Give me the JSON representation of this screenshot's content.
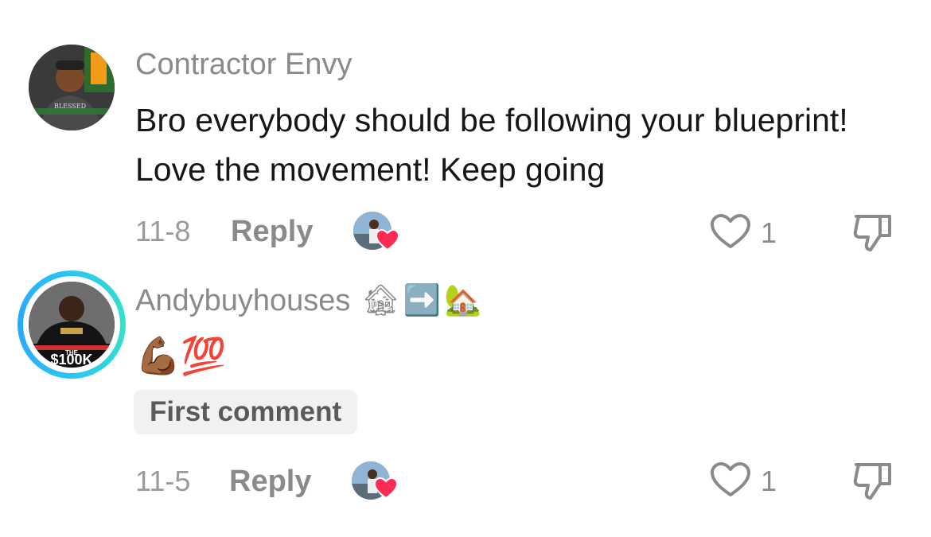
{
  "comments": [
    {
      "username": "Contractor Envy",
      "text": "Bro everybody should be following your blueprint! Love the movement! Keep going",
      "date": "11-8",
      "reply_label": "Reply",
      "like_count": "1"
    },
    {
      "username": "Andybuyhouses",
      "username_emojis": [
        "🏚",
        "➡️",
        "🏡"
      ],
      "text": "💪🏾💯",
      "badge": "First comment",
      "date": "11-5",
      "reply_label": "Reply",
      "like_count": "1",
      "avatar_text": "THE $100K"
    }
  ],
  "icons": {
    "like": "heart-outline-icon",
    "dislike": "thumbs-down-icon",
    "creator_liked": "red-heart-icon"
  },
  "colors": {
    "creator_heart": "#fe2c55",
    "story_ring": "#29c6f5"
  }
}
